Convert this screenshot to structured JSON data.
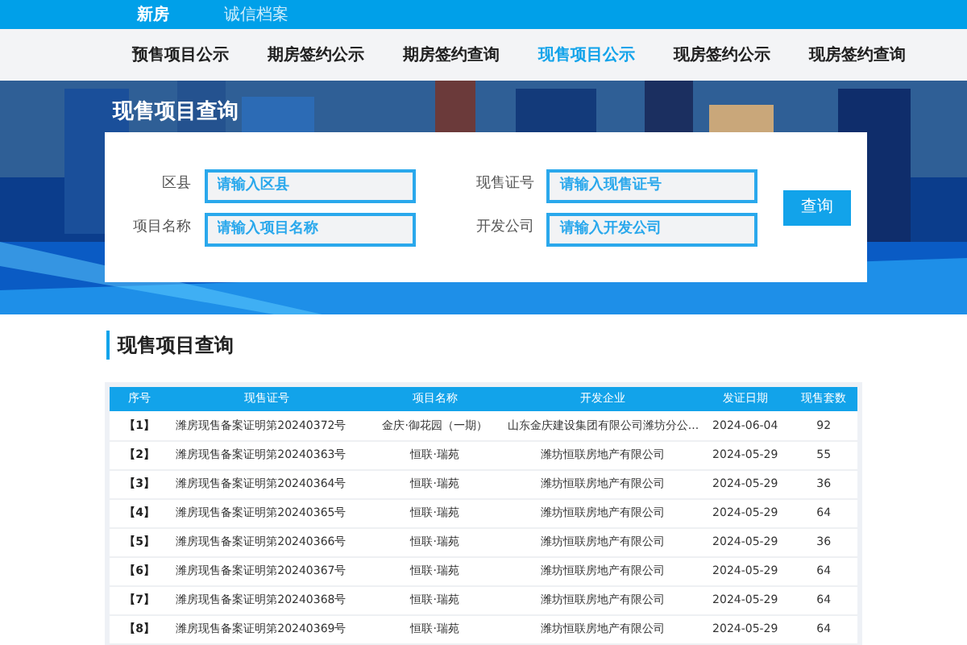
{
  "top_nav": [
    {
      "label": "新房",
      "selected": true
    },
    {
      "label": "诚信档案",
      "selected": false
    }
  ],
  "sub_nav": [
    {
      "label": "预售项目公示",
      "selected": false
    },
    {
      "label": "期房签约公示",
      "selected": false
    },
    {
      "label": "期房签约查询",
      "selected": false
    },
    {
      "label": "现售项目公示",
      "selected": true
    },
    {
      "label": "现房签约公示",
      "selected": false
    },
    {
      "label": "现房签约查询",
      "selected": false
    }
  ],
  "banner_title": "现售项目查询",
  "search_fields": [
    {
      "label": "区县",
      "placeholder": "请输入区县"
    },
    {
      "label": "现售证号",
      "placeholder": "请输入现售证号"
    },
    {
      "label": "项目名称",
      "placeholder": "请输入项目名称"
    },
    {
      "label": "开发公司",
      "placeholder": "请输入开发公司"
    }
  ],
  "search_button": "查询",
  "section_title": "现售项目查询",
  "table": {
    "columns": [
      "序号",
      "现售证号",
      "项目名称",
      "开发企业",
      "发证日期",
      "现售套数"
    ],
    "rows": [
      [
        "【1】",
        "潍房现售备案证明第20240372号",
        "金庆·御花园（一期）",
        "山东金庆建设集团有限公司潍坊分公...",
        "2024-06-04",
        "92"
      ],
      [
        "【2】",
        "潍房现售备案证明第20240363号",
        "恒联·瑞苑",
        "潍坊恒联房地产有限公司",
        "2024-05-29",
        "55"
      ],
      [
        "【3】",
        "潍房现售备案证明第20240364号",
        "恒联·瑞苑",
        "潍坊恒联房地产有限公司",
        "2024-05-29",
        "36"
      ],
      [
        "【4】",
        "潍房现售备案证明第20240365号",
        "恒联·瑞苑",
        "潍坊恒联房地产有限公司",
        "2024-05-29",
        "64"
      ],
      [
        "【5】",
        "潍房现售备案证明第20240366号",
        "恒联·瑞苑",
        "潍坊恒联房地产有限公司",
        "2024-05-29",
        "36"
      ],
      [
        "【6】",
        "潍房现售备案证明第20240367号",
        "恒联·瑞苑",
        "潍坊恒联房地产有限公司",
        "2024-05-29",
        "64"
      ],
      [
        "【7】",
        "潍房现售备案证明第20240368号",
        "恒联·瑞苑",
        "潍坊恒联房地产有限公司",
        "2024-05-29",
        "64"
      ],
      [
        "【8】",
        "潍房现售备案证明第20240369号",
        "恒联·瑞苑",
        "潍坊恒联房地产有限公司",
        "2024-05-29",
        "64"
      ]
    ]
  }
}
